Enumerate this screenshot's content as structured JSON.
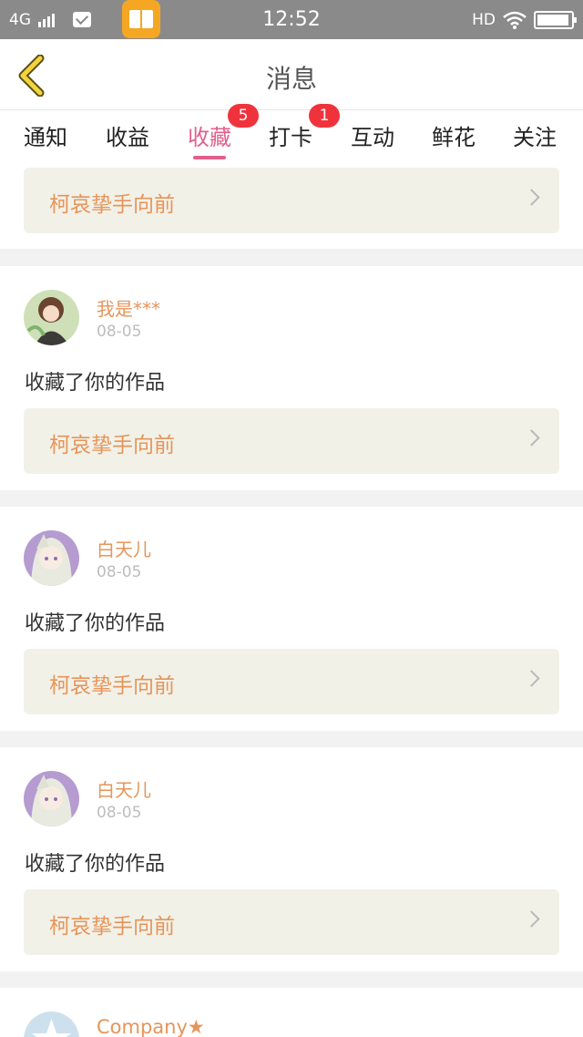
{
  "status_bar": {
    "network": "4G",
    "time": "12:52",
    "hd": "HD"
  },
  "header": {
    "title": "消息",
    "back_icon": "chevron-left-icon"
  },
  "tabs": [
    {
      "label": "通知"
    },
    {
      "label": "收益"
    },
    {
      "label": "收藏",
      "badge": "5",
      "active": true
    },
    {
      "label": "打卡",
      "badge": "1"
    },
    {
      "label": "互动"
    },
    {
      "label": "鲜花"
    },
    {
      "label": "关注"
    }
  ],
  "top_link": {
    "title": "柯哀挚手向前"
  },
  "messages": [
    {
      "username": "我是***",
      "date": "08-05",
      "action": "收藏了你的作品",
      "work_title": "柯哀挚手向前"
    },
    {
      "username": "白天儿",
      "date": "08-05",
      "action": "收藏了你的作品",
      "work_title": "柯哀挚手向前"
    },
    {
      "username": "白天儿",
      "date": "08-05",
      "action": "收藏了你的作品",
      "work_title": "柯哀挚手向前"
    },
    {
      "username": "Company★"
    }
  ],
  "colors": {
    "accent": "#e0608a",
    "link_text": "#e6955a",
    "badge": "#f0323c",
    "link_bg": "#f2f1e8"
  }
}
